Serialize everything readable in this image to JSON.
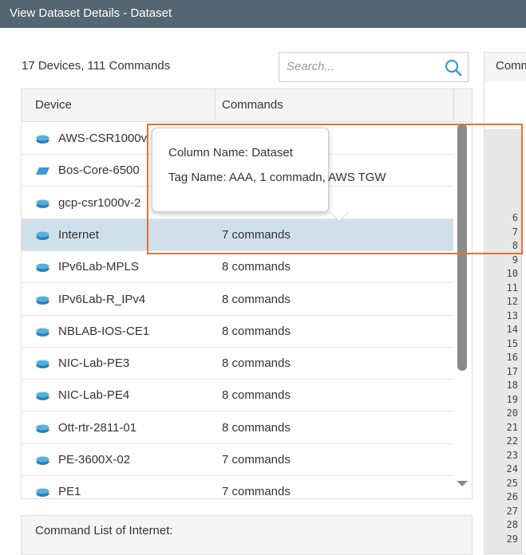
{
  "title": "View Dataset Details - Dataset",
  "summary": "17 Devices,  111 Commands",
  "search": {
    "placeholder": "Search..."
  },
  "grid": {
    "columns": [
      "Device",
      "Commands"
    ],
    "rows": [
      {
        "device": "AWS-CSR1000v",
        "commands": "",
        "icon": "router"
      },
      {
        "device": "Bos-Core-6500",
        "commands": "",
        "icon": "switch"
      },
      {
        "device": "gcp-csr1000v-2",
        "commands": "",
        "icon": "router"
      },
      {
        "device": "Internet",
        "commands": "7 commands",
        "icon": "router",
        "selected": true
      },
      {
        "device": "IPv6Lab-MPLS",
        "commands": "8 commands",
        "icon": "router"
      },
      {
        "device": "IPv6Lab-R_IPv4",
        "commands": "8 commands",
        "icon": "router"
      },
      {
        "device": "NBLAB-IOS-CE1",
        "commands": "8 commands",
        "icon": "router"
      },
      {
        "device": "NIC-Lab-PE3",
        "commands": "8 commands",
        "icon": "router"
      },
      {
        "device": "NIC-Lab-PE4",
        "commands": "8 commands",
        "icon": "router"
      },
      {
        "device": "Ott-rtr-2811-01",
        "commands": "8 commands",
        "icon": "router"
      },
      {
        "device": "PE-3600X-02",
        "commands": "7 commands",
        "icon": "router"
      },
      {
        "device": "PE1",
        "commands": "7 commands",
        "icon": "router"
      }
    ]
  },
  "tooltip": {
    "column": "Column Name: Dataset",
    "tag": "Tag Name: AAA, 1 commadn, AWS TGW"
  },
  "command_list_title": "Command List of Internet:",
  "right_panel": {
    "header": "Comm",
    "line_numbers": [
      "6",
      "7",
      "8",
      "9",
      "10",
      "11",
      "12",
      "13",
      "14",
      "15",
      "16",
      "17",
      "18",
      "19",
      "20",
      "21",
      "22",
      "23",
      "24",
      "25",
      "26",
      "27",
      "28",
      "29"
    ]
  },
  "colors": {
    "titlebar": "#556673",
    "selected_row": "#cfe0ea",
    "highlight": "#e8722f",
    "icon": "#3d9ad1"
  }
}
